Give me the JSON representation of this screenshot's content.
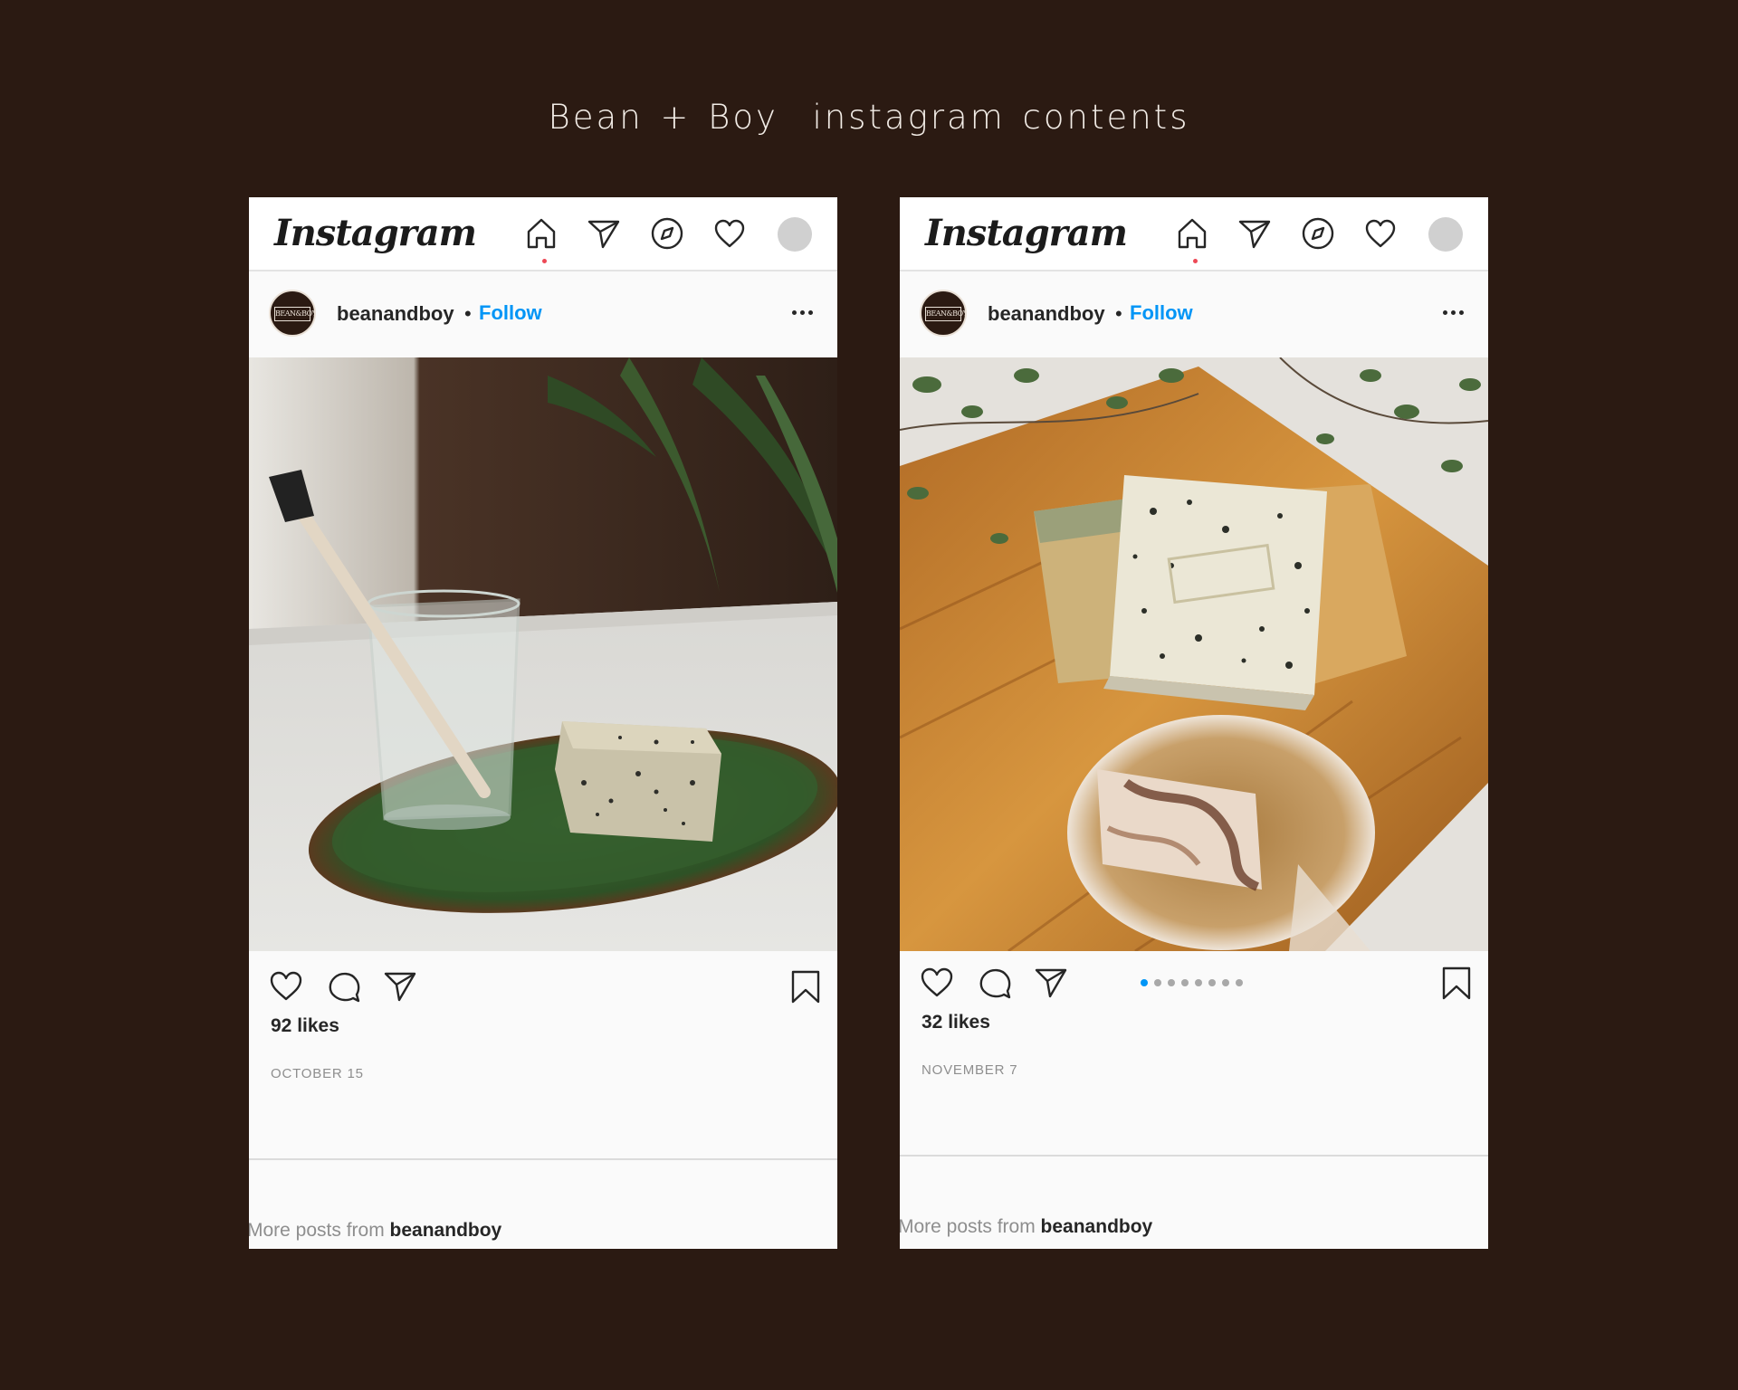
{
  "page": {
    "title": "Bean + Boy  instagram contents"
  },
  "colors": {
    "background": "#2b1a12",
    "follow_blue": "#0095f6",
    "card": "#fafafa"
  },
  "posts": [
    {
      "app_logo": "Instagram",
      "nav_icons": [
        "home-icon",
        "direct-send-icon",
        "explore-compass-icon",
        "activity-heart-icon",
        "profile-avatar"
      ],
      "avatar_text": "BEAN&BOY",
      "username": "beanandboy",
      "separator": "•",
      "follow_label": "Follow",
      "likes": "92 likes",
      "date": "OCTOBER 15",
      "more_posts_label": "More posts from ",
      "more_posts_user": "beanandboy",
      "carousel": null
    },
    {
      "app_logo": "Instagram",
      "nav_icons": [
        "home-icon",
        "direct-send-icon",
        "explore-compass-icon",
        "activity-heart-icon",
        "profile-avatar"
      ],
      "avatar_text": "BEAN&BOY",
      "username": "beanandboy",
      "separator": "•",
      "follow_label": "Follow",
      "likes": "32 likes",
      "date": "NOVEMBER 7",
      "more_posts_label": "More posts from ",
      "more_posts_user": "beanandboy",
      "carousel": {
        "count": 8,
        "active": 1
      }
    }
  ]
}
